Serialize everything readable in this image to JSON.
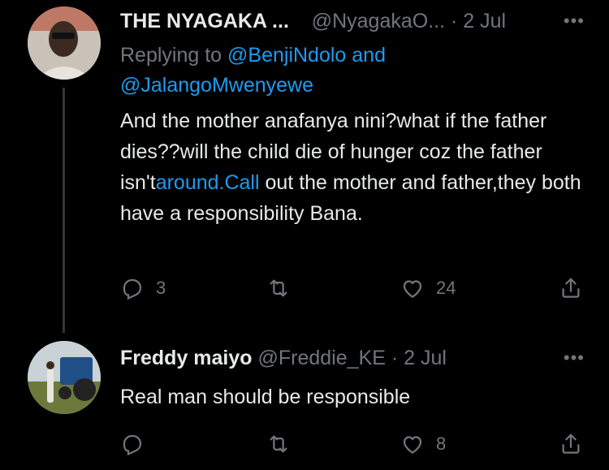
{
  "tweets": [
    {
      "name": "THE NYAGAKA ...",
      "handle": "@NyagakaO...",
      "dot": "·",
      "date": "2 Jul",
      "more": "•••",
      "replying_prefix": "Replying to",
      "mention1": "@BenjiNdolo",
      "and": "and",
      "mention2": "@JalangoMwenyewe",
      "text_part1": "And the mother anafanya nini?what if  the father dies??will the child die of hunger coz the father isn't",
      "text_link": "around.Call",
      "text_part2": " out the mother and father,they both have a responsibility Bana.",
      "replies": "3",
      "retweets": "",
      "likes": "24"
    },
    {
      "name": "Freddy maiyo",
      "handle": "@Freddie_KE",
      "dot": "·",
      "date": "2 Jul",
      "more": "•••",
      "text": "Real man should be responsible",
      "replies": "",
      "retweets": "",
      "likes": "8"
    }
  ],
  "colors": {
    "background": "#000000",
    "text": "#e7e9ea",
    "muted": "#71767b",
    "link": "#1d9bf0"
  },
  "icons": [
    "reply-icon",
    "retweet-icon",
    "like-icon",
    "share-icon",
    "more-icon"
  ]
}
